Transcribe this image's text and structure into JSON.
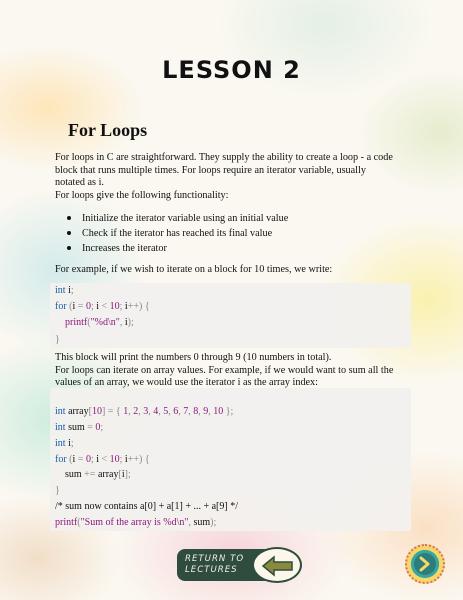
{
  "lesson_title": "LESSON 2",
  "section_heading": "For Loops",
  "intro_lines": [
    "For loops in C are straightforward. They supply the ability to create a loop - a code",
    "block that runs multiple times. For loops require an iterator variable, usually",
    "notated as i.",
    "For loops give the following functionality:"
  ],
  "bullets": [
    "Initialize the iterator variable using an initial value",
    "Check if the iterator has reached its final value",
    "Increases the iterator"
  ],
  "example_intro": "For example, if we wish to iterate on a block for 10 times, we write:",
  "code_block_1": [
    [
      [
        "kw",
        "int"
      ],
      [
        "pl",
        " i"
      ],
      [
        "pn",
        ";"
      ]
    ],
    [
      [
        "kw",
        "for"
      ],
      [
        "pn",
        " ("
      ],
      [
        "pl",
        "i"
      ],
      [
        "pn",
        " = "
      ],
      [
        "num",
        "0"
      ],
      [
        "pn",
        "; "
      ],
      [
        "pl",
        "i"
      ],
      [
        "pn",
        " < "
      ],
      [
        "num",
        "10"
      ],
      [
        "pn",
        "; "
      ],
      [
        "pl",
        "i"
      ],
      [
        "pn",
        "++) {"
      ]
    ],
    [
      [
        "pl",
        "    "
      ],
      [
        "fn",
        "printf"
      ],
      [
        "pn",
        "("
      ],
      [
        "str",
        "\"%d\\n\""
      ],
      [
        "pn",
        ", "
      ],
      [
        "pl",
        "i"
      ],
      [
        "pn",
        ");"
      ]
    ],
    [
      [
        "pn",
        "}"
      ]
    ]
  ],
  "middle_lines": [
    "This block will print the numbers 0 through 9 (10 numbers in total).",
    "For loops can iterate on array values. For example, if we would want to sum all the",
    "values of an array, we would use the iterator i as the array index:"
  ],
  "code_block_2": [
    [],
    [
      [
        "kw",
        "int"
      ],
      [
        "pl",
        " array"
      ],
      [
        "pn",
        "["
      ],
      [
        "num",
        "10"
      ],
      [
        "pn",
        "] = { "
      ],
      [
        "num",
        "1"
      ],
      [
        "pn",
        ", "
      ],
      [
        "num",
        "2"
      ],
      [
        "pn",
        ", "
      ],
      [
        "num",
        "3"
      ],
      [
        "pn",
        ", "
      ],
      [
        "num",
        "4"
      ],
      [
        "pn",
        ", "
      ],
      [
        "num",
        "5"
      ],
      [
        "pn",
        ", "
      ],
      [
        "num",
        "6"
      ],
      [
        "pn",
        ", "
      ],
      [
        "num",
        "7"
      ],
      [
        "pn",
        ", "
      ],
      [
        "num",
        "8"
      ],
      [
        "pn",
        ", "
      ],
      [
        "num",
        "9"
      ],
      [
        "pn",
        ", "
      ],
      [
        "num",
        "10"
      ],
      [
        "pn",
        " };"
      ]
    ],
    [
      [
        "kw",
        "int"
      ],
      [
        "pl",
        " sum"
      ],
      [
        "pn",
        " = "
      ],
      [
        "num",
        "0"
      ],
      [
        "pn",
        ";"
      ]
    ],
    [
      [
        "kw",
        "int"
      ],
      [
        "pl",
        " i"
      ],
      [
        "pn",
        ";"
      ]
    ],
    [
      [
        "kw",
        "for"
      ],
      [
        "pn",
        " ("
      ],
      [
        "pl",
        "i"
      ],
      [
        "pn",
        " = "
      ],
      [
        "num",
        "0"
      ],
      [
        "pn",
        "; "
      ],
      [
        "pl",
        "i"
      ],
      [
        "pn",
        " < "
      ],
      [
        "num",
        "10"
      ],
      [
        "pn",
        "; "
      ],
      [
        "pl",
        "i"
      ],
      [
        "pn",
        "++) {"
      ]
    ],
    [
      [
        "pl",
        "    sum"
      ],
      [
        "pn",
        " += "
      ],
      [
        "pl",
        "array"
      ],
      [
        "pn",
        "["
      ],
      [
        "pl",
        "i"
      ],
      [
        "pn",
        "];"
      ]
    ],
    [
      [
        "pn",
        "}"
      ]
    ],
    [
      [
        "cm",
        "/* sum now contains a[0] + a[1] + ... + a[9] */"
      ]
    ],
    [
      [
        "fn",
        "printf"
      ],
      [
        "pn",
        "("
      ],
      [
        "str",
        "\"Sum of the array is %d\\n\""
      ],
      [
        "pn",
        ", "
      ],
      [
        "pl",
        "sum"
      ],
      [
        "pn",
        ");"
      ]
    ]
  ],
  "return_button": {
    "line1": "RETURN TO",
    "line2": "LECTURES"
  },
  "icons": {
    "back": "arrow-left-icon",
    "next": "chevron-right-icon"
  },
  "colors": {
    "keyword": "#1a5fa8",
    "string": "#8a1a7a",
    "button_bg": "#2f4d3e",
    "next_button": "#2d7d7c"
  }
}
